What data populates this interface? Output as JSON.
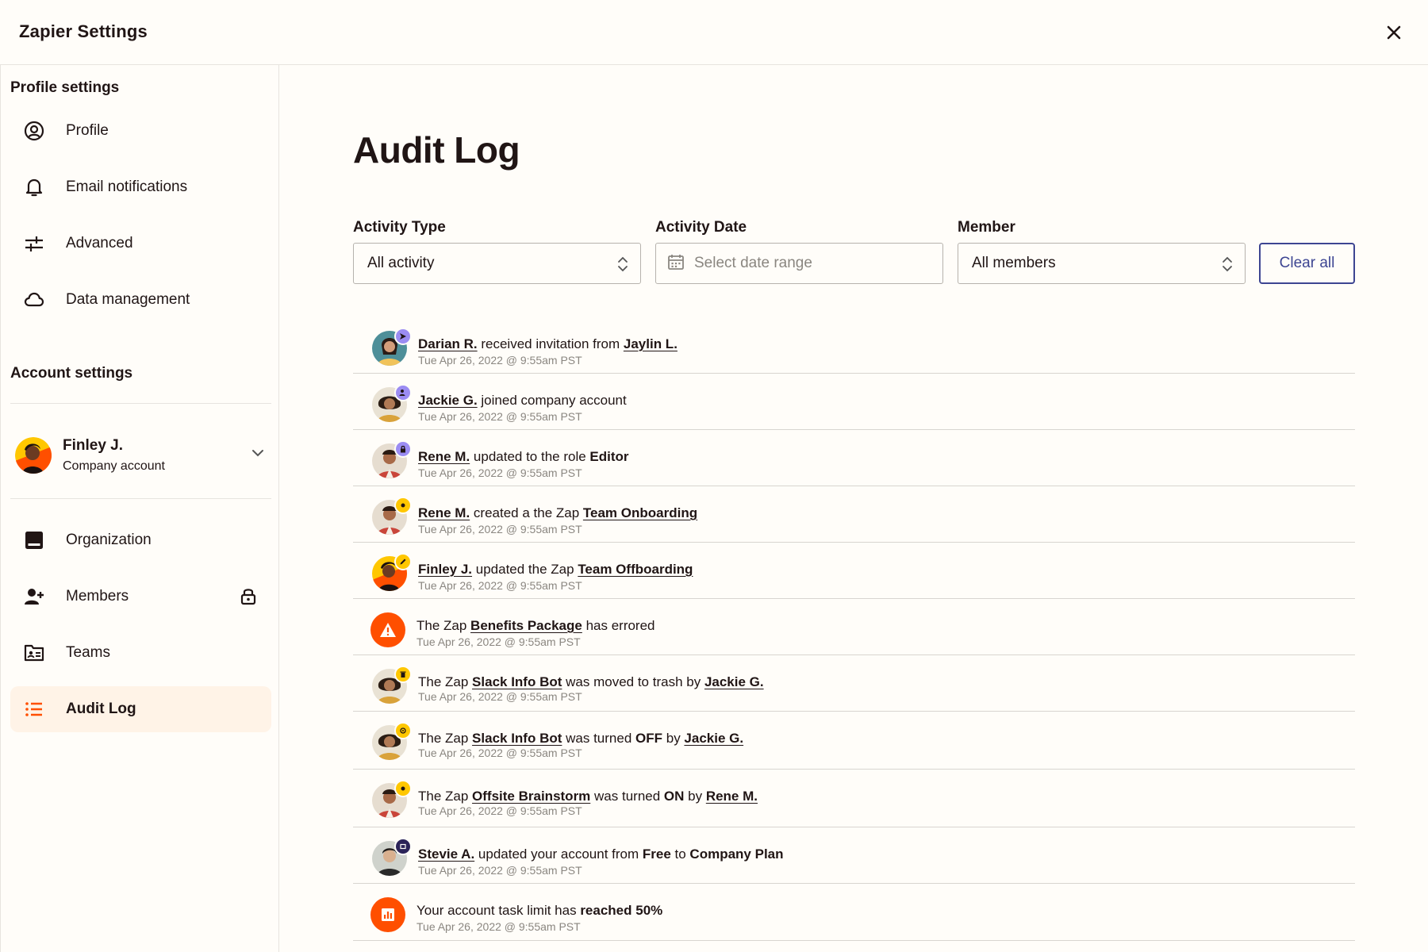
{
  "window": {
    "title": "Zapier Settings"
  },
  "sidebar": {
    "profile_heading": "Profile settings",
    "profile_items": [
      {
        "label": "Profile",
        "icon": "user-circle-icon"
      },
      {
        "label": "Email notifications",
        "icon": "bell-icon"
      },
      {
        "label": "Advanced",
        "icon": "sliders-icon"
      },
      {
        "label": "Data management",
        "icon": "cloud-icon"
      }
    ],
    "account_heading": "Account settings",
    "account": {
      "name": "Finley J.",
      "type": "Company account"
    },
    "account_items": [
      {
        "label": "Organization",
        "icon": "organization-icon"
      },
      {
        "label": "Members",
        "icon": "add-member-icon",
        "locked": true
      },
      {
        "label": "Teams",
        "icon": "teams-icon"
      },
      {
        "label": "Audit Log",
        "icon": "list-icon",
        "active": true
      }
    ]
  },
  "main": {
    "title": "Audit Log",
    "filters": {
      "activity_type": {
        "label": "Activity Type",
        "value": "All activity"
      },
      "activity_date": {
        "label": "Activity Date",
        "placeholder": "Select date range"
      },
      "member": {
        "label": "Member",
        "value": "All members"
      },
      "clear_label": "Clear all"
    },
    "log": [
      {
        "parts": [
          "Darian R.",
          " received invitation from ",
          "Jaylin L."
        ],
        "time": "Tue Apr 26, 2022 @ 9:55am PST"
      },
      {
        "parts": [
          "Jackie G.",
          " joined company account"
        ],
        "time": "Tue Apr 26, 2022 @ 9:55am PST"
      },
      {
        "parts": [
          "Rene M.",
          " updated to the role ",
          "Editor"
        ],
        "time": "Tue Apr 26, 2022 @ 9:55am PST"
      },
      {
        "parts": [
          "Rene M.",
          " created a the Zap ",
          "Team Onboarding"
        ],
        "time": "Tue Apr 26, 2022 @ 9:55am PST"
      },
      {
        "parts": [
          "Finley J.",
          " updated the Zap ",
          "Team Offboarding"
        ],
        "time": "Tue Apr 26, 2022 @ 9:55am PST"
      },
      {
        "parts": [
          "The Zap ",
          "Benefits Package",
          " has errored"
        ],
        "time": "Tue Apr 26, 2022 @ 9:55am PST"
      },
      {
        "parts": [
          "The Zap ",
          "Slack Info Bot",
          " was moved to trash by ",
          "Jackie G."
        ],
        "time": "Tue Apr 26, 2022 @ 9:55am PST"
      },
      {
        "parts": [
          "The Zap ",
          "Slack Info Bot",
          " was turned ",
          "OFF",
          " by ",
          "Jackie G."
        ],
        "time": "Tue Apr 26, 2022 @ 9:55am PST"
      },
      {
        "parts": [
          "The Zap ",
          "Offsite Brainstorm",
          " was turned ",
          "ON",
          " by ",
          "Rene M."
        ],
        "time": "Tue Apr 26, 2022 @ 9:55am PST"
      },
      {
        "parts": [
          "Stevie A.",
          " updated your account from ",
          "Free",
          " to ",
          "Company Plan"
        ],
        "time": "Tue Apr 26, 2022 @ 9:55am PST"
      },
      {
        "parts": [
          "Your account task limit has ",
          "reached 50%"
        ],
        "time": "Tue Apr 26, 2022 @ 9:55am PST"
      }
    ]
  },
  "colors": {
    "accent": "#ff4f00",
    "link_blue": "#3d4592",
    "active_bg": "#fff3e7",
    "badge_purple": "#9b8cf2",
    "badge_yellow": "#ffc700"
  }
}
